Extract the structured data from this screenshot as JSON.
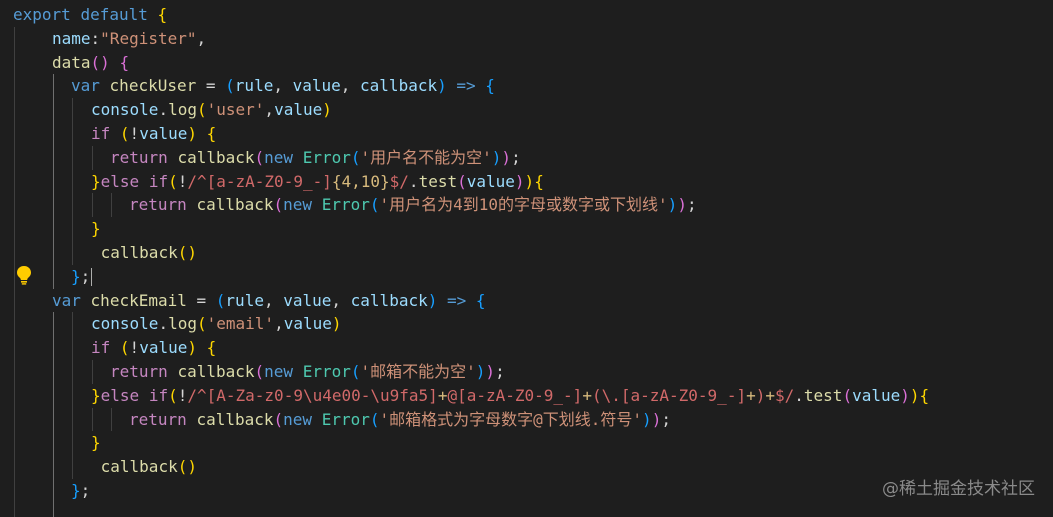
{
  "editor": {
    "colors": {
      "background": "#1e1e1e",
      "keyword": "#569cd6",
      "control": "#c586c0",
      "function": "#dcdcaa",
      "variable": "#9cdcfe",
      "string": "#ce9178",
      "regex": "#d16969",
      "class": "#4ec9b0",
      "bracket_level1": "#ffd700",
      "bracket_level2": "#da70d6",
      "bracket_level3": "#179fff"
    },
    "lightbulb_icon": "lightbulb-icon",
    "watermark": "@稀土掘金技术社区",
    "lines": [
      {
        "guides": [],
        "tokens": [
          [
            "kw",
            "export"
          ],
          [
            "op",
            " "
          ],
          [
            "kw",
            "default"
          ],
          [
            "op",
            " "
          ],
          [
            "b1",
            "{"
          ]
        ]
      },
      {
        "guides": [
          0
        ],
        "tokens": [
          [
            "var",
            "name"
          ],
          [
            "op",
            ":"
          ],
          [
            "str",
            "\"Register\""
          ],
          [
            "op",
            ","
          ]
        ]
      },
      {
        "guides": [
          0
        ],
        "tokens": [
          [
            "fn",
            "data"
          ],
          [
            "b2",
            "()"
          ],
          [
            "op",
            " "
          ],
          [
            "b2",
            "{"
          ]
        ]
      },
      {
        "guides": [
          0,
          1
        ],
        "tokens": [
          [
            "kw",
            "var"
          ],
          [
            "op",
            " "
          ],
          [
            "fn",
            "checkUser"
          ],
          [
            "op",
            " = "
          ],
          [
            "b3",
            "("
          ],
          [
            "var",
            "rule"
          ],
          [
            "op",
            ", "
          ],
          [
            "var",
            "value"
          ],
          [
            "op",
            ", "
          ],
          [
            "var",
            "callback"
          ],
          [
            "b3",
            ")"
          ],
          [
            "op",
            " "
          ],
          [
            "kw",
            "=>"
          ],
          [
            "op",
            " "
          ],
          [
            "b3",
            "{"
          ]
        ]
      },
      {
        "guides": [
          0,
          1,
          2
        ],
        "tokens": [
          [
            "var",
            "console"
          ],
          [
            "op",
            "."
          ],
          [
            "fn",
            "log"
          ],
          [
            "b1",
            "("
          ],
          [
            "str",
            "'user'"
          ],
          [
            "op",
            ","
          ],
          [
            "var",
            "value"
          ],
          [
            "b1",
            ")"
          ]
        ]
      },
      {
        "guides": [
          0,
          1,
          2
        ],
        "tokens": [
          [
            "ctl",
            "if"
          ],
          [
            "op",
            " "
          ],
          [
            "b1",
            "("
          ],
          [
            "op",
            "!"
          ],
          [
            "var",
            "value"
          ],
          [
            "b1",
            ")"
          ],
          [
            "op",
            " "
          ],
          [
            "b1",
            "{"
          ]
        ]
      },
      {
        "guides": [
          0,
          1,
          2,
          3
        ],
        "tokens": [
          [
            "ctl",
            "return"
          ],
          [
            "op",
            " "
          ],
          [
            "fn",
            "callback"
          ],
          [
            "b2",
            "("
          ],
          [
            "kw",
            "new"
          ],
          [
            "op",
            " "
          ],
          [
            "cls",
            "Error"
          ],
          [
            "b3",
            "("
          ],
          [
            "str",
            "'用户名不能为空'"
          ],
          [
            "b3",
            ")"
          ],
          [
            "b2",
            ")"
          ],
          [
            "op",
            ";"
          ]
        ]
      },
      {
        "guides": [
          0,
          1,
          2
        ],
        "tokens": [
          [
            "b1",
            "}"
          ],
          [
            "ctl",
            "else"
          ],
          [
            "op",
            " "
          ],
          [
            "ctl",
            "if"
          ],
          [
            "b1",
            "("
          ],
          [
            "op",
            "!"
          ],
          [
            "rx",
            "/^[a-zA-Z0-9_-]"
          ],
          [
            "rxq",
            "{4,10}"
          ],
          [
            "rx",
            "$/"
          ],
          [
            "op",
            "."
          ],
          [
            "fn",
            "test"
          ],
          [
            "b2",
            "("
          ],
          [
            "var",
            "value"
          ],
          [
            "b2",
            ")"
          ],
          [
            "b1",
            ")"
          ],
          [
            "b1",
            "{"
          ]
        ]
      },
      {
        "guides": [
          0,
          1,
          2,
          3,
          4
        ],
        "tokens": [
          [
            "ctl",
            "return"
          ],
          [
            "op",
            " "
          ],
          [
            "fn",
            "callback"
          ],
          [
            "b2",
            "("
          ],
          [
            "kw",
            "new"
          ],
          [
            "op",
            " "
          ],
          [
            "cls",
            "Error"
          ],
          [
            "b3",
            "("
          ],
          [
            "str",
            "'用户名为4到10的字母或数字或下划线'"
          ],
          [
            "b3",
            ")"
          ],
          [
            "b2",
            ")"
          ],
          [
            "op",
            ";"
          ]
        ]
      },
      {
        "guides": [
          0,
          1,
          2
        ],
        "tokens": [
          [
            "b1",
            "}"
          ]
        ]
      },
      {
        "guides": [
          0,
          1,
          2
        ],
        "tokens": [
          [
            "op",
            " "
          ],
          [
            "fn",
            "callback"
          ],
          [
            "b1",
            "()"
          ]
        ]
      },
      {
        "guides": [
          0,
          1
        ],
        "tokens": [
          [
            "b3",
            "}"
          ],
          [
            "op",
            ";"
          ]
        ],
        "cursor": true
      },
      {
        "guides": [
          0
        ],
        "tokens": [
          [
            "kw",
            "var"
          ],
          [
            "op",
            " "
          ],
          [
            "fn",
            "checkEmail"
          ],
          [
            "op",
            " = "
          ],
          [
            "b3",
            "("
          ],
          [
            "var",
            "rule"
          ],
          [
            "op",
            ", "
          ],
          [
            "var",
            "value"
          ],
          [
            "op",
            ", "
          ],
          [
            "var",
            "callback"
          ],
          [
            "b3",
            ")"
          ],
          [
            "op",
            " "
          ],
          [
            "kw",
            "=>"
          ],
          [
            "op",
            " "
          ],
          [
            "b3",
            "{"
          ]
        ]
      },
      {
        "guides": [
          0,
          1,
          2
        ],
        "tokens": [
          [
            "var",
            "console"
          ],
          [
            "op",
            "."
          ],
          [
            "fn",
            "log"
          ],
          [
            "b1",
            "("
          ],
          [
            "str",
            "'email'"
          ],
          [
            "op",
            ","
          ],
          [
            "var",
            "value"
          ],
          [
            "b1",
            ")"
          ]
        ]
      },
      {
        "guides": [
          0,
          1,
          2
        ],
        "tokens": [
          [
            "ctl",
            "if"
          ],
          [
            "op",
            " "
          ],
          [
            "b1",
            "("
          ],
          [
            "op",
            "!"
          ],
          [
            "var",
            "value"
          ],
          [
            "b1",
            ")"
          ],
          [
            "op",
            " "
          ],
          [
            "b1",
            "{"
          ]
        ]
      },
      {
        "guides": [
          0,
          1,
          2,
          3
        ],
        "tokens": [
          [
            "ctl",
            "return"
          ],
          [
            "op",
            " "
          ],
          [
            "fn",
            "callback"
          ],
          [
            "b2",
            "("
          ],
          [
            "kw",
            "new"
          ],
          [
            "op",
            " "
          ],
          [
            "cls",
            "Error"
          ],
          [
            "b3",
            "("
          ],
          [
            "str",
            "'邮箱不能为空'"
          ],
          [
            "b3",
            ")"
          ],
          [
            "b2",
            ")"
          ],
          [
            "op",
            ";"
          ]
        ]
      },
      {
        "guides": [
          0,
          1,
          2
        ],
        "tokens": [
          [
            "b1",
            "}"
          ],
          [
            "ctl",
            "else"
          ],
          [
            "op",
            " "
          ],
          [
            "ctl",
            "if"
          ],
          [
            "b1",
            "("
          ],
          [
            "op",
            "!"
          ],
          [
            "rx",
            "/^[A-Za-z0-9\\u4e00-\\u9fa5]"
          ],
          [
            "rxq",
            "+"
          ],
          [
            "rx",
            "@[a-zA-Z0-9_-]"
          ],
          [
            "rxq",
            "+"
          ],
          [
            "rx",
            "(\\.[a-zA-Z0-9_-]"
          ],
          [
            "rxq",
            "+"
          ],
          [
            "rx",
            ")"
          ],
          [
            "rxq",
            "+"
          ],
          [
            "rx",
            "$/"
          ],
          [
            "op",
            "."
          ],
          [
            "fn",
            "test"
          ],
          [
            "b2",
            "("
          ],
          [
            "var",
            "value"
          ],
          [
            "b2",
            ")"
          ],
          [
            "b1",
            ")"
          ],
          [
            "b1",
            "{"
          ]
        ]
      },
      {
        "guides": [
          0,
          1,
          2,
          3,
          4
        ],
        "tokens": [
          [
            "ctl",
            "return"
          ],
          [
            "op",
            " "
          ],
          [
            "fn",
            "callback"
          ],
          [
            "b2",
            "("
          ],
          [
            "kw",
            "new"
          ],
          [
            "op",
            " "
          ],
          [
            "cls",
            "Error"
          ],
          [
            "b3",
            "("
          ],
          [
            "str",
            "'邮箱格式为字母数字@下划线.符号'"
          ],
          [
            "b3",
            ")"
          ],
          [
            "b2",
            ")"
          ],
          [
            "op",
            ";"
          ]
        ]
      },
      {
        "guides": [
          0,
          1,
          2
        ],
        "tokens": [
          [
            "b1",
            "}"
          ]
        ]
      },
      {
        "guides": [
          0,
          1,
          2
        ],
        "tokens": [
          [
            "op",
            " "
          ],
          [
            "fn",
            "callback"
          ],
          [
            "b1",
            "()"
          ]
        ]
      },
      {
        "guides": [
          0,
          1
        ],
        "tokens": [
          [
            "b3",
            "}"
          ],
          [
            "op",
            ";"
          ]
        ]
      },
      {
        "guides": [
          0,
          1
        ],
        "tokens": []
      }
    ]
  }
}
